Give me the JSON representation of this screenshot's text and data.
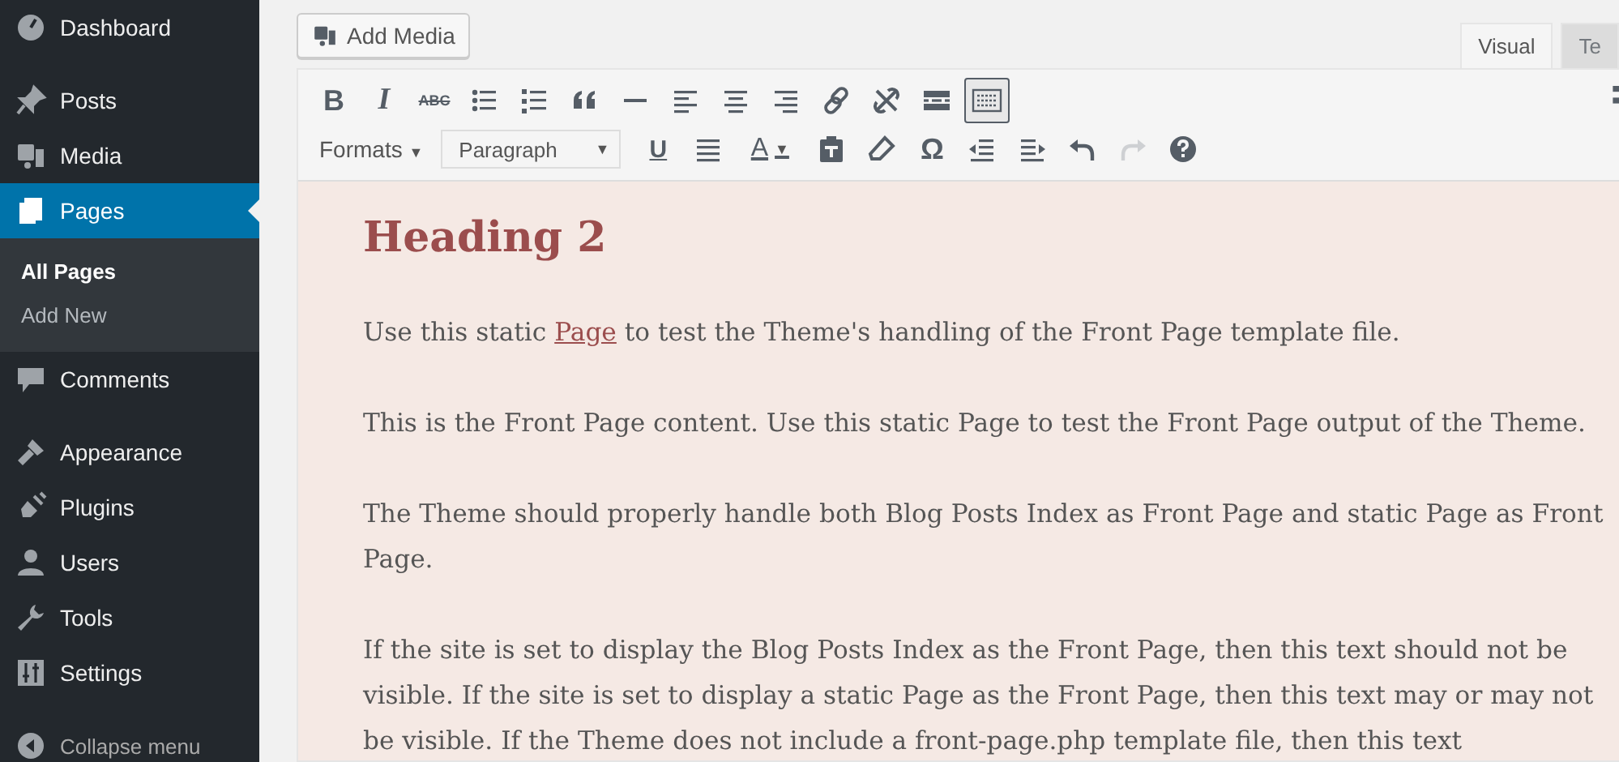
{
  "sidebar": {
    "groups": [
      [
        {
          "label": "Dashboard",
          "selected": false
        }
      ],
      [
        {
          "label": "Posts",
          "selected": false
        },
        {
          "label": "Media",
          "selected": false
        },
        {
          "label": "Pages",
          "selected": true,
          "submenu": [
            {
              "label": "All Pages",
              "selected": true
            },
            {
              "label": "Add New",
              "selected": false
            }
          ]
        },
        {
          "label": "Comments",
          "selected": false
        }
      ],
      [
        {
          "label": "Appearance",
          "selected": false
        },
        {
          "label": "Plugins",
          "selected": false
        },
        {
          "label": "Users",
          "selected": false
        },
        {
          "label": "Tools",
          "selected": false
        },
        {
          "label": "Settings",
          "selected": false
        }
      ]
    ],
    "collapse": "Collapse menu"
  },
  "add_media": "Add Media",
  "editor_tabs": [
    {
      "label": "Visual",
      "selected": true
    },
    {
      "label": "Te",
      "selected": false
    }
  ],
  "toolbar": {
    "primary_row": [
      {
        "kind": "bold",
        "glyph": "B",
        "active": false,
        "disabled": false
      },
      {
        "kind": "italic",
        "glyph": "I",
        "active": false,
        "disabled": false
      },
      {
        "kind": "strike",
        "glyph": "ABC",
        "active": false,
        "disabled": false
      },
      {
        "kind": "bullets",
        "active": false,
        "disabled": false
      },
      {
        "kind": "numbers",
        "active": false,
        "disabled": false
      },
      {
        "kind": "quote",
        "active": false,
        "disabled": false
      },
      {
        "kind": "rule",
        "active": false,
        "disabled": false
      },
      {
        "kind": "align-left",
        "active": false,
        "disabled": false
      },
      {
        "kind": "align-center",
        "active": false,
        "disabled": false
      },
      {
        "kind": "align-right",
        "active": false,
        "disabled": false
      },
      {
        "kind": "link",
        "active": false,
        "disabled": false
      },
      {
        "kind": "unlink",
        "active": false,
        "disabled": false
      },
      {
        "kind": "more",
        "active": false,
        "disabled": false
      },
      {
        "kind": "toolbar-toggle",
        "active": true,
        "disabled": false
      }
    ],
    "secondary_row": [
      {
        "kind": "menu",
        "label": "Formats",
        "caret": "▼"
      },
      {
        "kind": "select",
        "value": "Paragraph",
        "caret": "▼"
      },
      {
        "kind": "underline",
        "glyph": "U",
        "active": false,
        "disabled": false
      },
      {
        "kind": "justify",
        "active": false,
        "disabled": false
      },
      {
        "kind": "color",
        "glyph": "A",
        "caret": "▼",
        "active": false,
        "disabled": false
      },
      {
        "kind": "paste",
        "active": false,
        "disabled": false
      },
      {
        "kind": "eraser",
        "active": false,
        "disabled": false
      },
      {
        "kind": "special-char",
        "glyph": "Ω",
        "active": false,
        "disabled": false
      },
      {
        "kind": "outdent",
        "active": false,
        "disabled": false
      },
      {
        "kind": "indent",
        "active": false,
        "disabled": false
      },
      {
        "kind": "undo",
        "active": false,
        "disabled": false
      },
      {
        "kind": "redo",
        "active": false,
        "disabled": true
      },
      {
        "kind": "help",
        "active": false,
        "disabled": false
      }
    ]
  },
  "content": {
    "heading": "Heading 2",
    "paragraphs": [
      [
        {
          "text": "Use this static "
        },
        {
          "text": "Page",
          "link": true
        },
        {
          "text": " to test the Theme's handling of the Front Page template file."
        }
      ],
      [
        {
          "text": "This is the Front Page content. Use this static Page to test the Front Page output of the Theme."
        }
      ],
      [
        {
          "text": "The Theme should properly handle both Blog Posts Index as Front Page and static Page as Front Page."
        }
      ],
      [
        {
          "text": "If the site is set to display the Blog Posts Index as the Front Page, then this text should not be visible. If the site is set to display a static Page as the Front Page, then this text may or may not be visible. If the Theme does not include a front-page.php template file, then this text"
        }
      ]
    ]
  }
}
